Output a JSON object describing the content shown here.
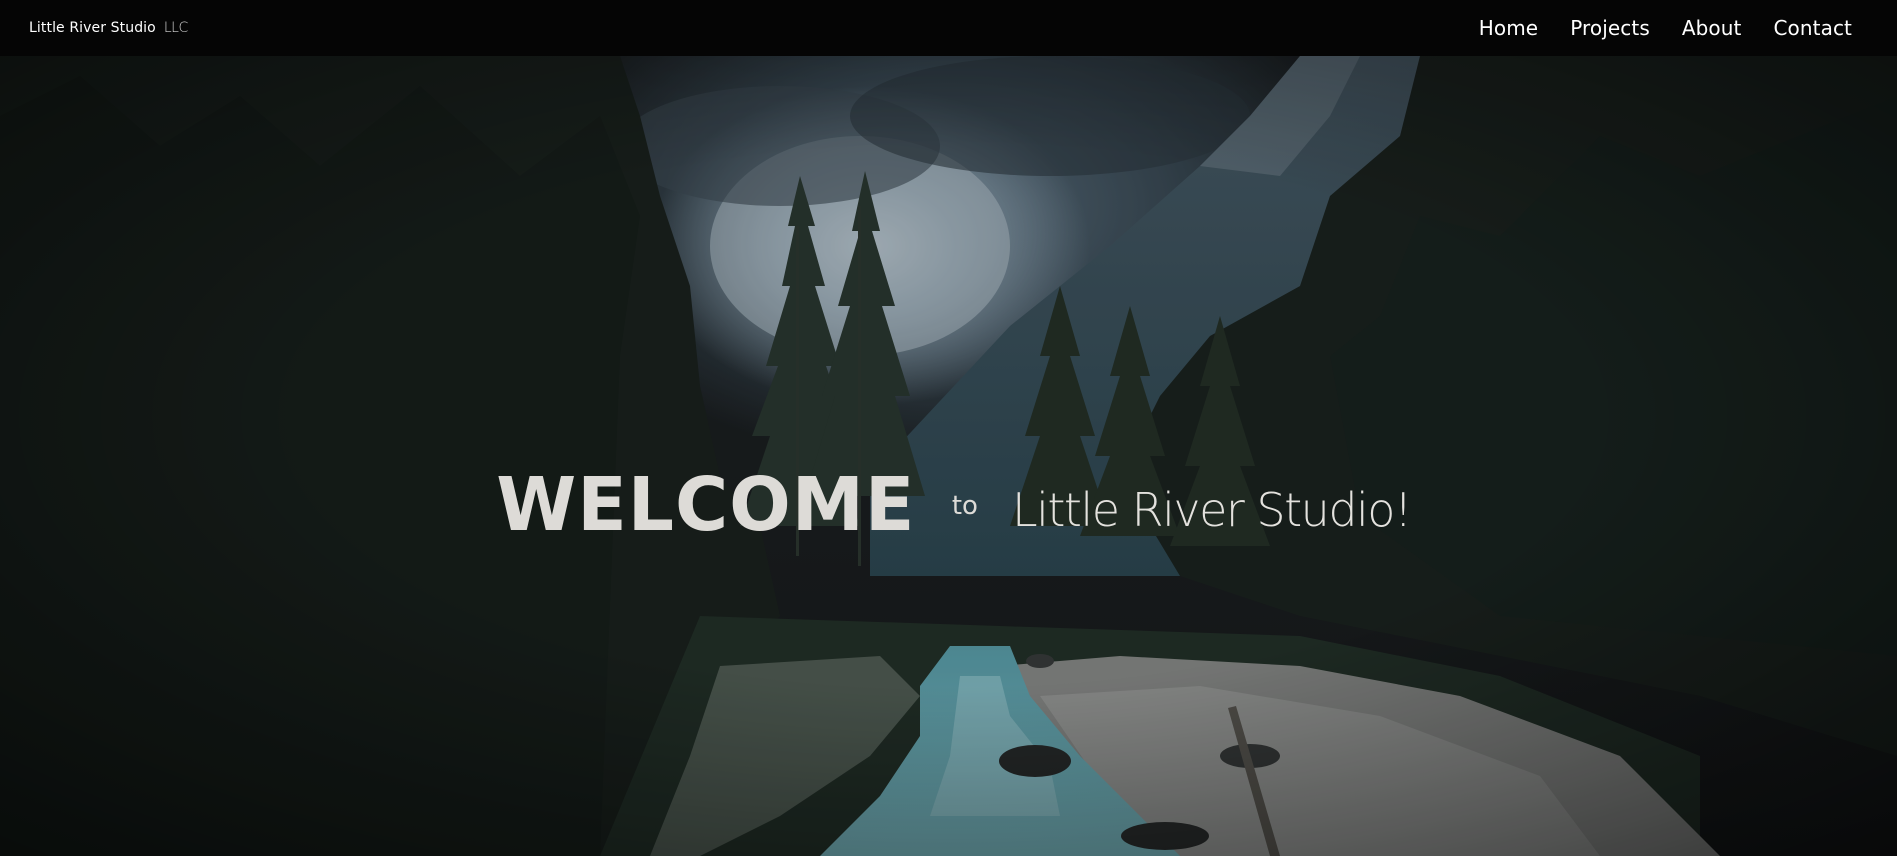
{
  "navbar": {
    "brand_name": "Little River Studio",
    "brand_suffix": "LLC",
    "links": [
      {
        "label": "Home"
      },
      {
        "label": "Projects"
      },
      {
        "label": "About"
      },
      {
        "label": "Contact"
      }
    ]
  },
  "hero": {
    "welcome": "WELCOME",
    "to": "to",
    "studio": "Little River Studio!"
  },
  "colors": {
    "nav_background": "#050505",
    "nav_text": "#ffffff",
    "hero_text": "#dddbd7",
    "river": "#6fb2bd",
    "forest": "#1f2a24"
  }
}
